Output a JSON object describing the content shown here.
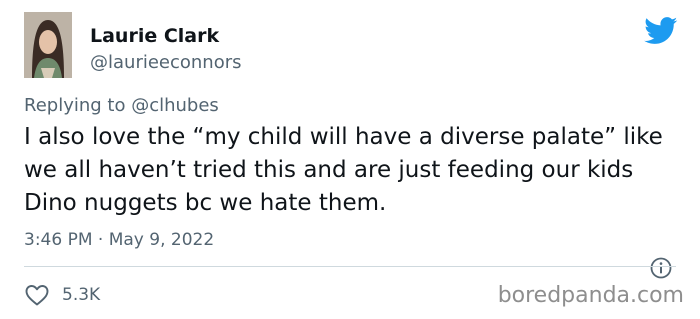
{
  "author": {
    "display_name": "Laurie Clark",
    "handle": "@laurieeconnors"
  },
  "reply": {
    "prefix": "Replying to ",
    "mention": "@clhubes"
  },
  "tweet": {
    "text": "I also love the “my child will have a diverse palate” like we all haven’t tried this and are just feeding our kids Dino nuggets bc we hate them.",
    "timestamp": "3:46 PM · May 9, 2022",
    "likes": "5.3K"
  },
  "icons": {
    "brand": "twitter-bird-icon",
    "info": "info-icon",
    "like": "heart-icon"
  },
  "colors": {
    "brand": "#1d9bf0",
    "secondary_text": "#536471",
    "divider": "#cfd9de"
  },
  "watermark": "boredpanda.com"
}
